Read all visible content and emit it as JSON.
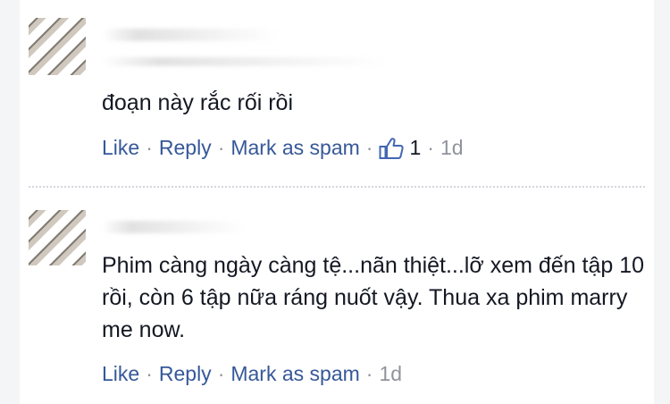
{
  "comments": [
    {
      "text": "đoạn này rắc rối rồi",
      "actions": {
        "like": "Like",
        "reply": "Reply",
        "spam": "Mark as spam"
      },
      "likes": "1",
      "time": "1d"
    },
    {
      "text": "Phim càng ngày càng tệ...nãn thiệt...lỡ xem đến tập 10 rồi, còn 6 tập nữa ráng nuốt vậy. Thua xa phim marry me now.",
      "actions": {
        "like": "Like",
        "reply": "Reply",
        "spam": "Mark as spam"
      },
      "time": "1d"
    }
  ],
  "separator": "·",
  "colors": {
    "link": "#365899",
    "text": "#141823",
    "meta": "#8f949c"
  },
  "icons": {
    "like_count_icon": "thumbs-up-icon"
  }
}
